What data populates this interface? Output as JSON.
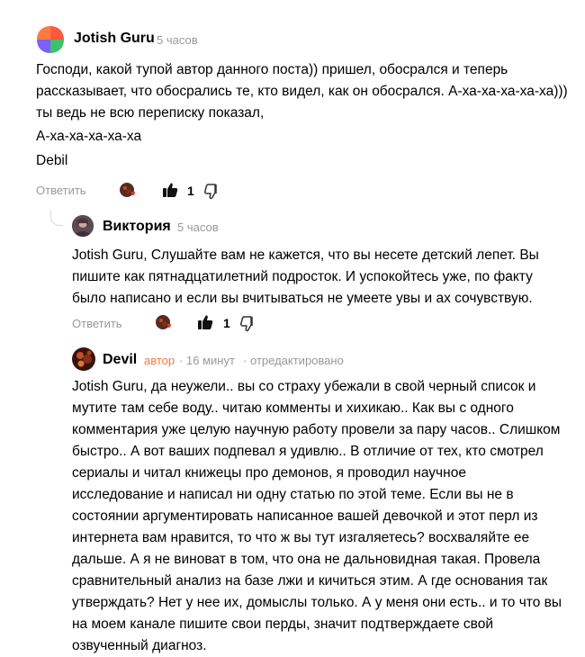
{
  "comments": [
    {
      "author": "Jotish Guru",
      "time": "5 часов",
      "paragraphs": [
        [
          "Господи, какой тупой автор данного поста)) пришел, обосрался и теперь",
          "рассказывает, что обосрались те, кто видел, как он обосрался. А-ха-ха-ха-ха-ха)))",
          "ты ведь не всю переписку показал,"
        ],
        [
          "А-ха-ха-ха-ха-ха"
        ],
        [
          "Debil"
        ]
      ],
      "reply_label": "Ответить",
      "likes": "1"
    },
    {
      "author": "Виктория",
      "time": "5 часов",
      "lines": [
        "Jotish Guru, Слушайте вам не кажется, что вы несете детский лепет. Вы",
        "пишите как пятнадцатилетний подросток. И успокойтесь уже, по факту",
        "было написано и если вы вчитываться не умеете увы и ах сочувствую."
      ],
      "reply_label": "Ответить",
      "likes": "1"
    },
    {
      "author": "Devil",
      "badge": "автор",
      "sep1": "·",
      "time": "16 минут",
      "sep2": "·",
      "edited": "отредактировано",
      "lines": [
        "Jotish Guru, да неужели.. вы со страху убежали в свой черный список и",
        "мутите там себе воду.. читаю комменты и хихикаю.. Как вы с одного",
        "комментария уже целую научную работу провели за пару часов.. Слишком",
        "быстро.. А вот ваших подпевал я удивлю.. В отличие от тех, кто смотрел",
        "сериалы и читал книжецы про демонов, я проводил научное",
        "исследование и написал ни одну статью по этой теме. Если вы не в",
        "состоянии аргументировать написанное вашей девочкой и этот перл из",
        "интернета вам нравится, то что ж вы тут изгаляетесь? восхваляйте ее",
        "дальше. А я не виноват в том, что она не дальновидная такая. Провела",
        "сравнительный анализ на базе лжи и кичиться этим. А где основания так",
        "утверждать? Нет у нее их, домыслы только. А у меня они есть.. и то что вы",
        "на моем канале пишите свои перды, значит подтверждаете свой",
        "озвученный диагноз."
      ]
    }
  ],
  "colors": {
    "badge": "#f07b3f",
    "meta": "#999999",
    "heart": "#e53935"
  },
  "icons": [
    "avatar-logo",
    "reaction-avatar-icon",
    "thumbs-up-icon",
    "thumbs-down-icon"
  ]
}
